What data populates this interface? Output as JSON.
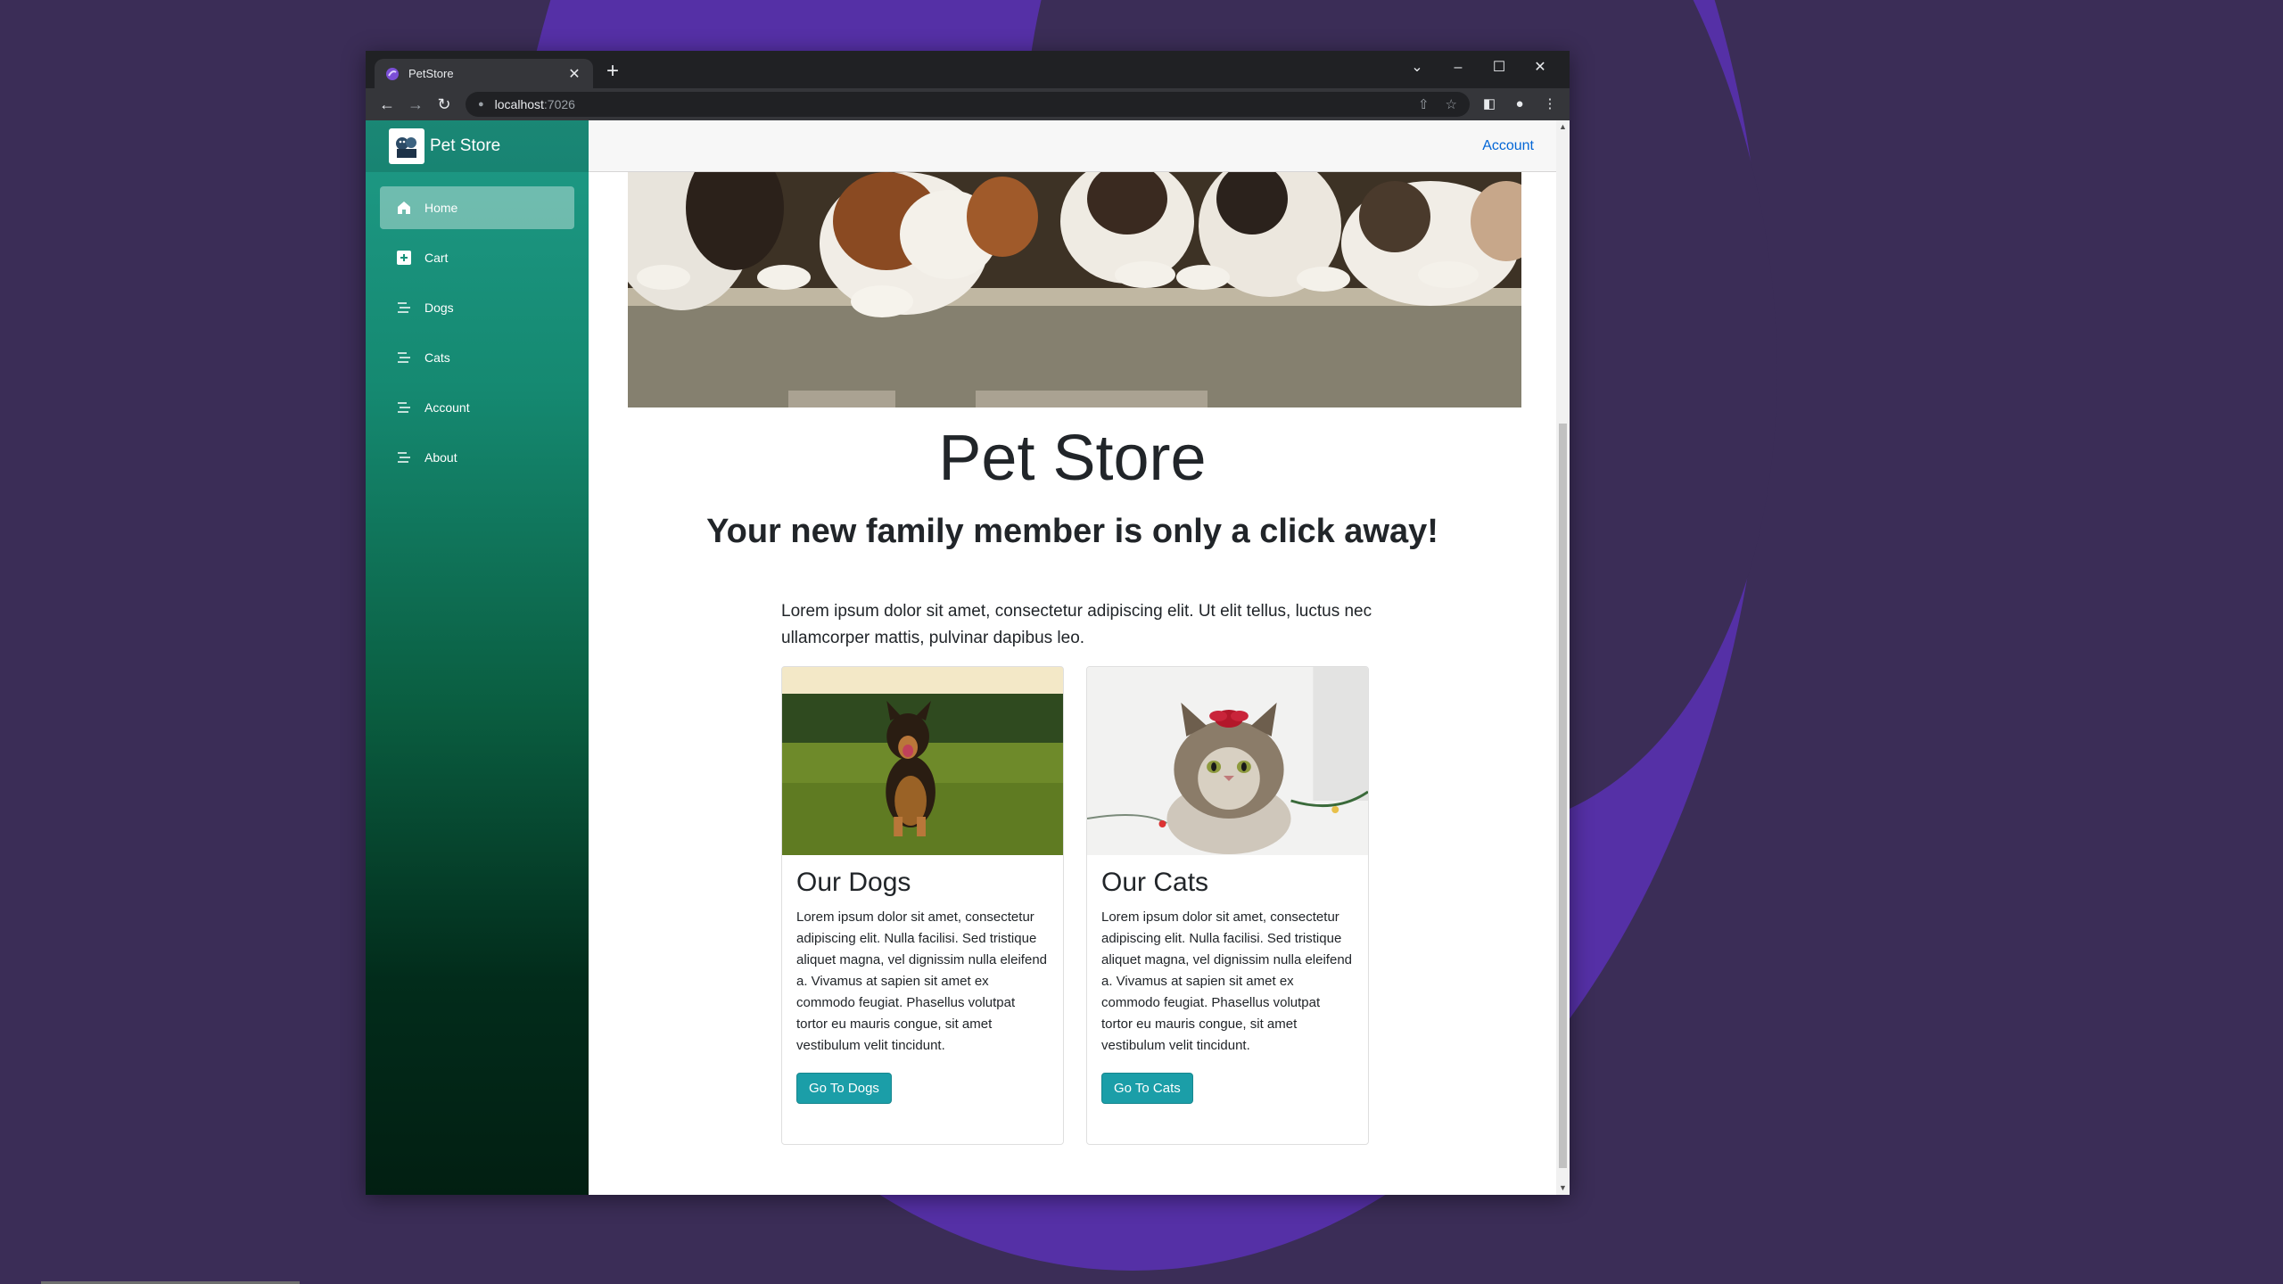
{
  "colors": {
    "sidebar_top": "#1e9a86",
    "sidebar_bottom": "#021f12",
    "button": "#1b9ea8",
    "link": "#0366d6",
    "desktop": "#3b2d57",
    "accent_shape": "#5530a6"
  },
  "browser": {
    "tab_title": "PetStore",
    "tab_close": "✕",
    "new_tab": "+",
    "url_host": "localhost",
    "url_port": ":7026",
    "controls": {
      "chevron": "⌄",
      "minimize": "–",
      "maximize": "☐",
      "close": "✕"
    },
    "nav": {
      "back": "←",
      "forward": "→",
      "reload": "↻"
    },
    "icons": [
      "share-icon",
      "star-icon",
      "side-panel-icon",
      "profile-icon",
      "menu-icon"
    ]
  },
  "sidebar": {
    "brand": "Pet Store",
    "items": [
      {
        "label": "Home",
        "icon": "home-icon",
        "active": true
      },
      {
        "label": "Cart",
        "icon": "plus-square-icon"
      },
      {
        "label": "Dogs",
        "icon": "list-icon"
      },
      {
        "label": "Cats",
        "icon": "list-icon"
      },
      {
        "label": "Account",
        "icon": "list-icon"
      },
      {
        "label": "About",
        "icon": "list-icon"
      }
    ]
  },
  "topbar": {
    "account_link": "Account"
  },
  "main": {
    "title": "Pet Store",
    "tagline": "Your new family member is only a click away!",
    "intro": "Lorem ipsum dolor sit amet, consectetur adipiscing elit. Ut elit tellus, luctus nec ullamcorper mattis, pulvinar dapibus leo."
  },
  "cards": {
    "dogs": {
      "title": "Our Dogs",
      "text": "Lorem ipsum dolor sit amet, consectetur adipiscing elit. Nulla facilisi. Sed tristique aliquet magna, vel dignissim nulla eleifend a. Vivamus at sapien sit amet ex commodo feugiat. Phasellus volutpat tortor eu mauris congue, sit amet vestibulum velit tincidunt.",
      "button": "Go To Dogs"
    },
    "cats": {
      "title": "Our Cats",
      "text": "Lorem ipsum dolor sit amet, consectetur adipiscing elit. Nulla facilisi. Sed tristique aliquet magna, vel dignissim nulla eleifend a. Vivamus at sapien sit amet ex commodo feugiat. Phasellus volutpat tortor eu mauris congue, sit amet vestibulum velit tincidunt.",
      "button": "Go To Cats"
    }
  }
}
